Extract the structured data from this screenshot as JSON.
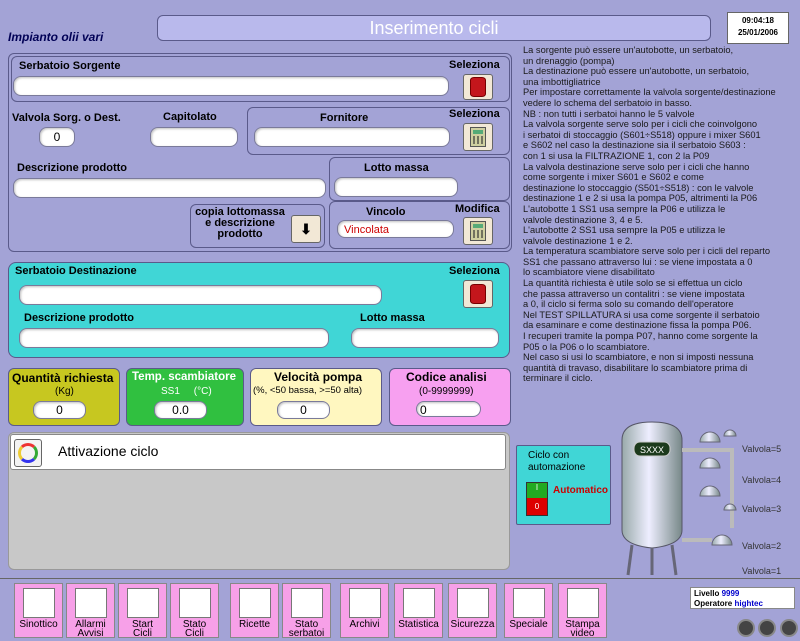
{
  "header": {
    "title": "Inserimento cicli",
    "plant": "Impianto olii vari",
    "time": "09:04:18",
    "date": "25/01/2006"
  },
  "source": {
    "title": "Serbatoio Sorgente",
    "select_label": "Seleziona",
    "valve_label": "Valvola Sorg. o Dest.",
    "valve_value": "0",
    "capitolato_label": "Capitolato",
    "fornitore_label": "Fornitore",
    "select2_label": "Seleziona",
    "descr_label": "Descrizione prodotto",
    "lotto_label": "Lotto massa",
    "copy_label_1": "copia lottomassa",
    "copy_label_2": "e descrizione",
    "copy_label_3": "prodotto",
    "vincolo_label": "Vincolo",
    "modifica_label": "Modifica",
    "vincolo_value": "Vincolata"
  },
  "dest": {
    "title": "Serbatoio Destinazione",
    "select_label": "Seleziona",
    "descr_label": "Descrizione prodotto",
    "lotto_label": "Lotto massa"
  },
  "params": {
    "qty_label": "Quantità richiesta",
    "qty_unit": "(Kg)",
    "qty_value": "0",
    "temp_label": "Temp. scambiatore",
    "temp_unit": "SS1     (°C)",
    "temp_value": "0.0",
    "vel_label": "Velocità pompa",
    "vel_unit": "(%, <50 bassa, >=50 alta)",
    "vel_value": "0",
    "code_label": "Codice analisi",
    "code_unit": "(0-9999999)",
    "code_value": "0"
  },
  "activation": {
    "label": "Attivazione ciclo"
  },
  "cycle": {
    "label_1": "Ciclo con",
    "label_2": "automazione",
    "mode": "Automatico"
  },
  "tank": {
    "label": "SXXX",
    "valves": [
      "Valvola=5",
      "Valvola=4",
      "Valvola=3",
      "Valvola=2",
      "Valvola=1"
    ]
  },
  "status": {
    "livello_label": "Livello",
    "livello_value": "9999",
    "operatore_label": "Operatore",
    "operatore_value": "hightec"
  },
  "nav": [
    {
      "l1": "Sinottico",
      "l2": ""
    },
    {
      "l1": "Allarmi",
      "l2": "Avvisi"
    },
    {
      "l1": "Start",
      "l2": "Cicli"
    },
    {
      "l1": "Stato",
      "l2": "Cicli"
    },
    {
      "l1": "Ricette",
      "l2": ""
    },
    {
      "l1": "Stato",
      "l2": "serbatoi"
    },
    {
      "l1": "Archivi",
      "l2": ""
    },
    {
      "l1": "Statistica",
      "l2": ""
    },
    {
      "l1": "Sicurezza",
      "l2": ""
    },
    {
      "l1": "Speciale",
      "l2": ""
    },
    {
      "l1": "Stampa",
      "l2": "video"
    }
  ],
  "help": [
    "La sorgente può essere un'autobotte, un serbatoio,",
    "un drenaggio (pompa)",
    "La destinazione può essere un'autobotte, un serbatoio,",
    "una imbottigliatrice",
    "Per impostare correttamente la valvola sorgente/destinazione",
    "vedere lo schema del serbatoio in basso.",
    "NB : non tutti i serbatoi hanno le 5 valvole",
    "La valvola sorgente serve solo per i cicli che coinvolgono",
    "i serbatoi di stoccaggio (S601÷S518) oppure i mixer S601",
    "e S602 nel caso la destinazione sia il serbatoio S603 :",
    "con 1 si usa la FILTRAZIONE 1, con 2 la P09",
    "La valvola destinazione serve solo per i cicli che hanno",
    "come sorgente i mixer S601 e S602 e come",
    "destinazione lo stoccaggio (S501÷S518) : con le valvole",
    "destinazione 1 e 2 si usa la pompa P05, altrimenti la P06",
    "L'autobotte 1 SS1 usa sempre la P06 e utilizza le",
    "valvole destinazione 3, 4 e 5.",
    "L'autobotte 2 SS1 usa sempre la P05 e utilizza le",
    "valvole destinazione 1 e 2.",
    "La temperatura scambiatore serve solo per i cicli del reparto",
    "SS1 che passano attraverso lui : se viene impostata a 0",
    "lo scambiatore viene disabilitato",
    "La quantità richiesta è utile solo se si effettua un ciclo",
    "che passa attraverso un contalitri : se viene impostata",
    "a 0, il ciclo si ferma solo su comando dell'operatore",
    "Nel TEST SPILLATURA si usa come sorgente il serbatoio",
    "da esaminare e come destinazione fissa la pompa P06.",
    "I recuperi tramite la pompa P07, hanno come sorgente la",
    "P05 o la P06 o lo scambiatore.",
    "Nel caso si usi lo scambiatore, e non si imposti nessuna",
    "quantità di travaso, disabilitare lo scambiatore prima di",
    "terminare il ciclo."
  ],
  "colors": {
    "bg": "#a3a3d6",
    "source_panel": "#a3a3d6",
    "dest_panel": "#40d6d6",
    "qty": "#c7c720",
    "temp": "#30c040",
    "vel": "#fff7c0",
    "code": "#f7a0f0",
    "nav": "#f7a0e8"
  }
}
